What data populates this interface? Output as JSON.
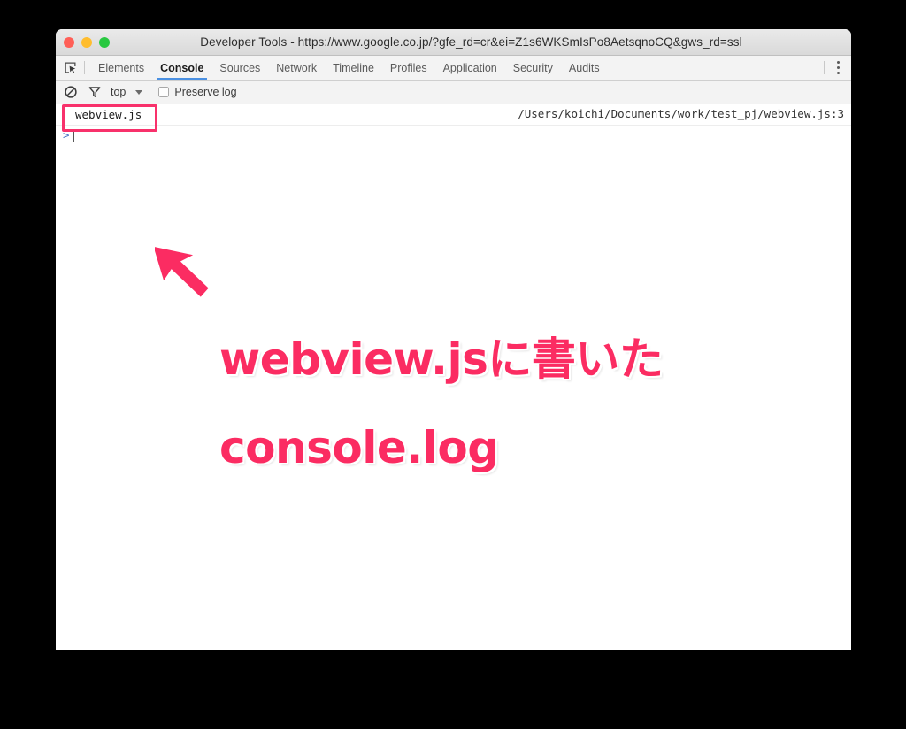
{
  "window": {
    "title": "Developer Tools - https://www.google.co.jp/?gfe_rd=cr&ei=Z1s6WKSmIsPo8AetsqnoCQ&gws_rd=ssl",
    "traffic_lights": [
      {
        "name": "close",
        "color": "#ff5f57"
      },
      {
        "name": "minimize",
        "color": "#ffbd2e"
      },
      {
        "name": "maximize",
        "color": "#28c840"
      }
    ]
  },
  "tabs": {
    "items": [
      {
        "label": "Elements",
        "active": false
      },
      {
        "label": "Console",
        "active": true
      },
      {
        "label": "Sources",
        "active": false
      },
      {
        "label": "Network",
        "active": false
      },
      {
        "label": "Timeline",
        "active": false
      },
      {
        "label": "Profiles",
        "active": false
      },
      {
        "label": "Application",
        "active": false
      },
      {
        "label": "Security",
        "active": false
      },
      {
        "label": "Audits",
        "active": false
      }
    ],
    "active_tab": "Console",
    "active_underline_color": "#4a90e2",
    "inspect_icon": "inspect-element-icon",
    "more_icon": "kebab-menu-icon"
  },
  "toolbar": {
    "clear_icon": "clear-console-icon",
    "filter_icon": "filter-funnel-icon",
    "context": "top",
    "context_caret_icon": "chevron-down-icon",
    "preserve_log_label": "Preserve log",
    "preserve_log_checked": false
  },
  "console": {
    "message": "webview.js",
    "source_link": "/Users/koichi/Documents/work/test_pj/webview.js:3",
    "prompt_chevron": ">",
    "prompt_value": ""
  },
  "annotation": {
    "caption_line1": "webview.jsに書いた",
    "caption_line2": "console.log",
    "accent_color": "#fb2c62",
    "highlight_color": "#f8316b",
    "arrow_icon": "pointer-arrow-icon",
    "highlight_icon": "highlight-box"
  }
}
